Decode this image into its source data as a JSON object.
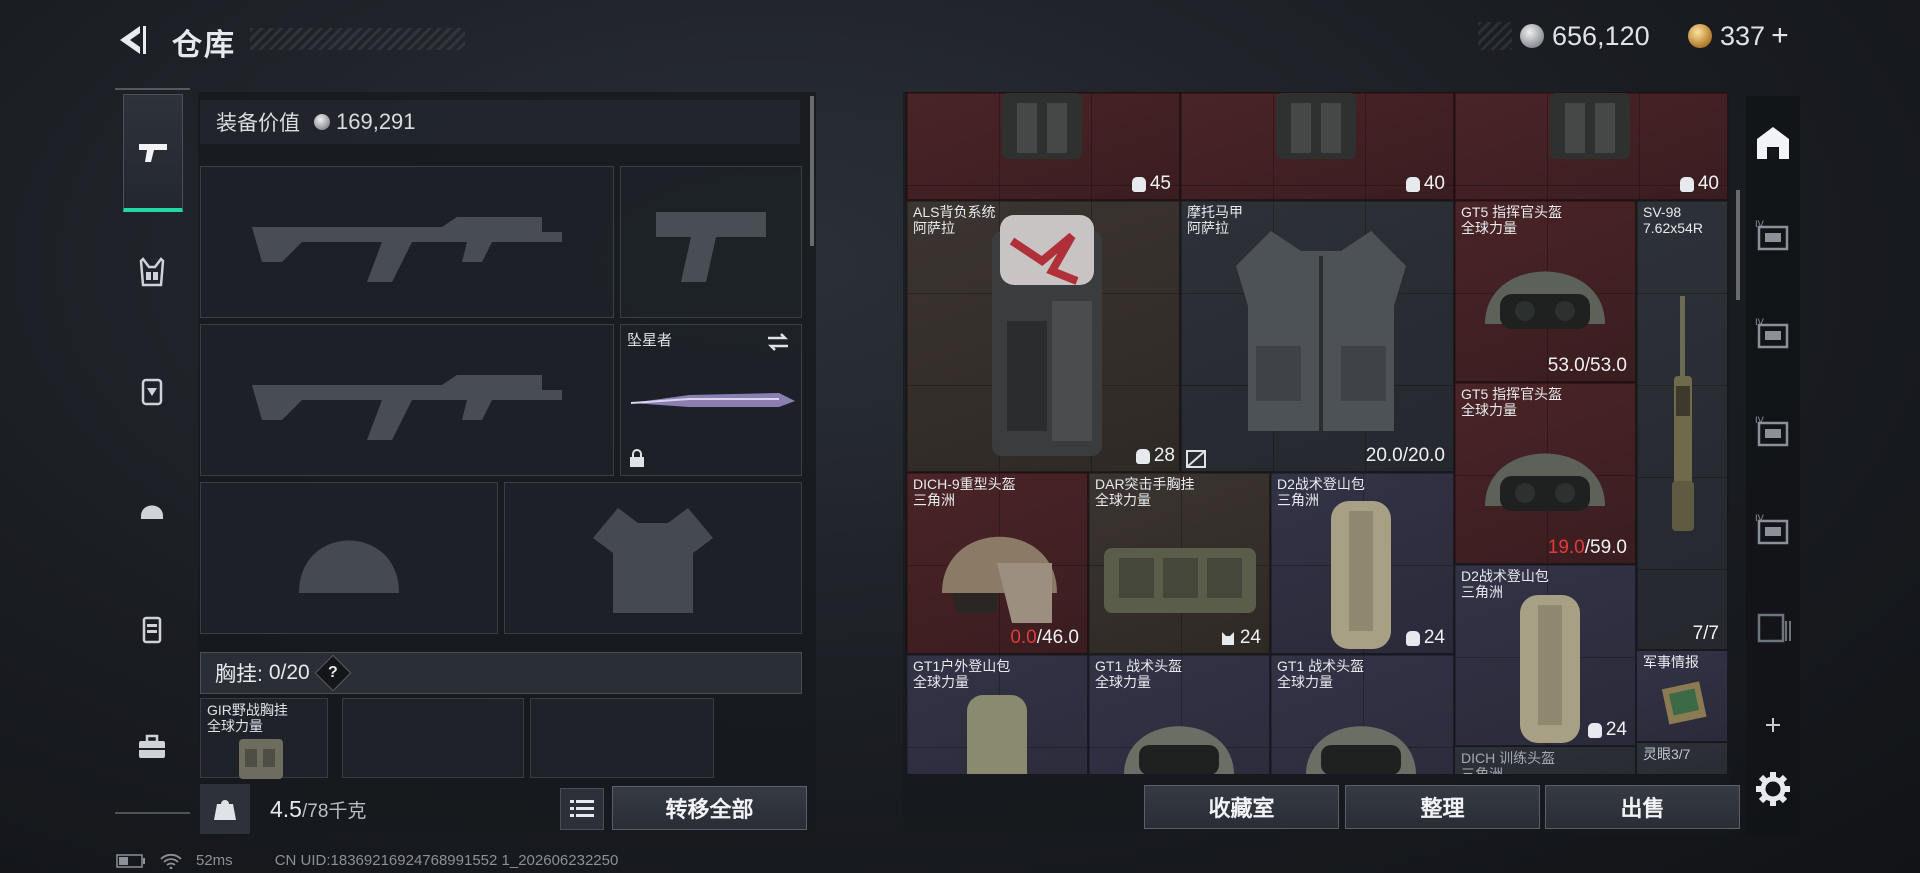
{
  "header": {
    "title": "仓库",
    "currency_silver": "656,120",
    "currency_gold": "337",
    "plus": "+"
  },
  "loadout": {
    "equip_value_label": "装备价值",
    "equip_value": "169,291",
    "melee_slot_name": "坠星者",
    "chest_rig_label": "胸挂:",
    "chest_rig_count": "0/20",
    "help": "?",
    "pocket_item_name": "GIR野战胸挂",
    "pocket_item_origin": "全球力量",
    "weight_value": "4.5",
    "weight_capacity": "/78千克",
    "transfer_all": "转移全部"
  },
  "storage": {
    "items": [
      {
        "qty": "45"
      },
      {
        "qty": "40"
      },
      {
        "qty": "40"
      },
      {
        "name": "ALS背负系统",
        "origin": "阿萨拉",
        "qty": "28"
      },
      {
        "name": "摩托马甲",
        "origin": "阿萨拉",
        "dur": "20.0/20.0"
      },
      {
        "name": "GT5 指挥官头盔",
        "origin": "全球力量",
        "dur": "53.0/53.0"
      },
      {
        "name": "SV-98",
        "origin": "7.62x54R",
        "qty": "7/7"
      },
      {
        "name": "GT5 指挥官头盔",
        "origin": "全球力量",
        "dur_low": "19.0",
        "dur_max": "/59.0"
      },
      {
        "name": "DICH-9重型头盔",
        "origin": "三角洲",
        "dur_low": "0.0",
        "dur_max": "/46.0"
      },
      {
        "name": "DAR突击手胸挂",
        "origin": "全球力量",
        "qty": "24"
      },
      {
        "name": "D2战术登山包",
        "origin": "三角洲",
        "qty": "24"
      },
      {
        "name": "D2战术登山包",
        "origin": "三角洲",
        "qty": "24"
      },
      {
        "name": "GT1户外登山包",
        "origin": "全球力量"
      },
      {
        "name": "GT1 战术头盔",
        "origin": "全球力量"
      },
      {
        "name": "GT1 战术头盔",
        "origin": "全球力量"
      },
      {
        "name": "军事情报"
      },
      {
        "name": "DICH 训练头盔",
        "origin": "三角洲"
      },
      {
        "name": "灵眼3/7"
      }
    ],
    "collection_room": "收藏室",
    "organize": "整理",
    "sell": "出售"
  },
  "status_bar": {
    "ping": "52ms",
    "uid": "CN UID:18369216924768991552 1_202606232250"
  },
  "colors": {
    "accent": "#21d8a7",
    "red_value": "#e53a3a",
    "rarity_red": "#4a2426",
    "rarity_purple": "#333346",
    "rarity_brown": "#3b3430"
  }
}
